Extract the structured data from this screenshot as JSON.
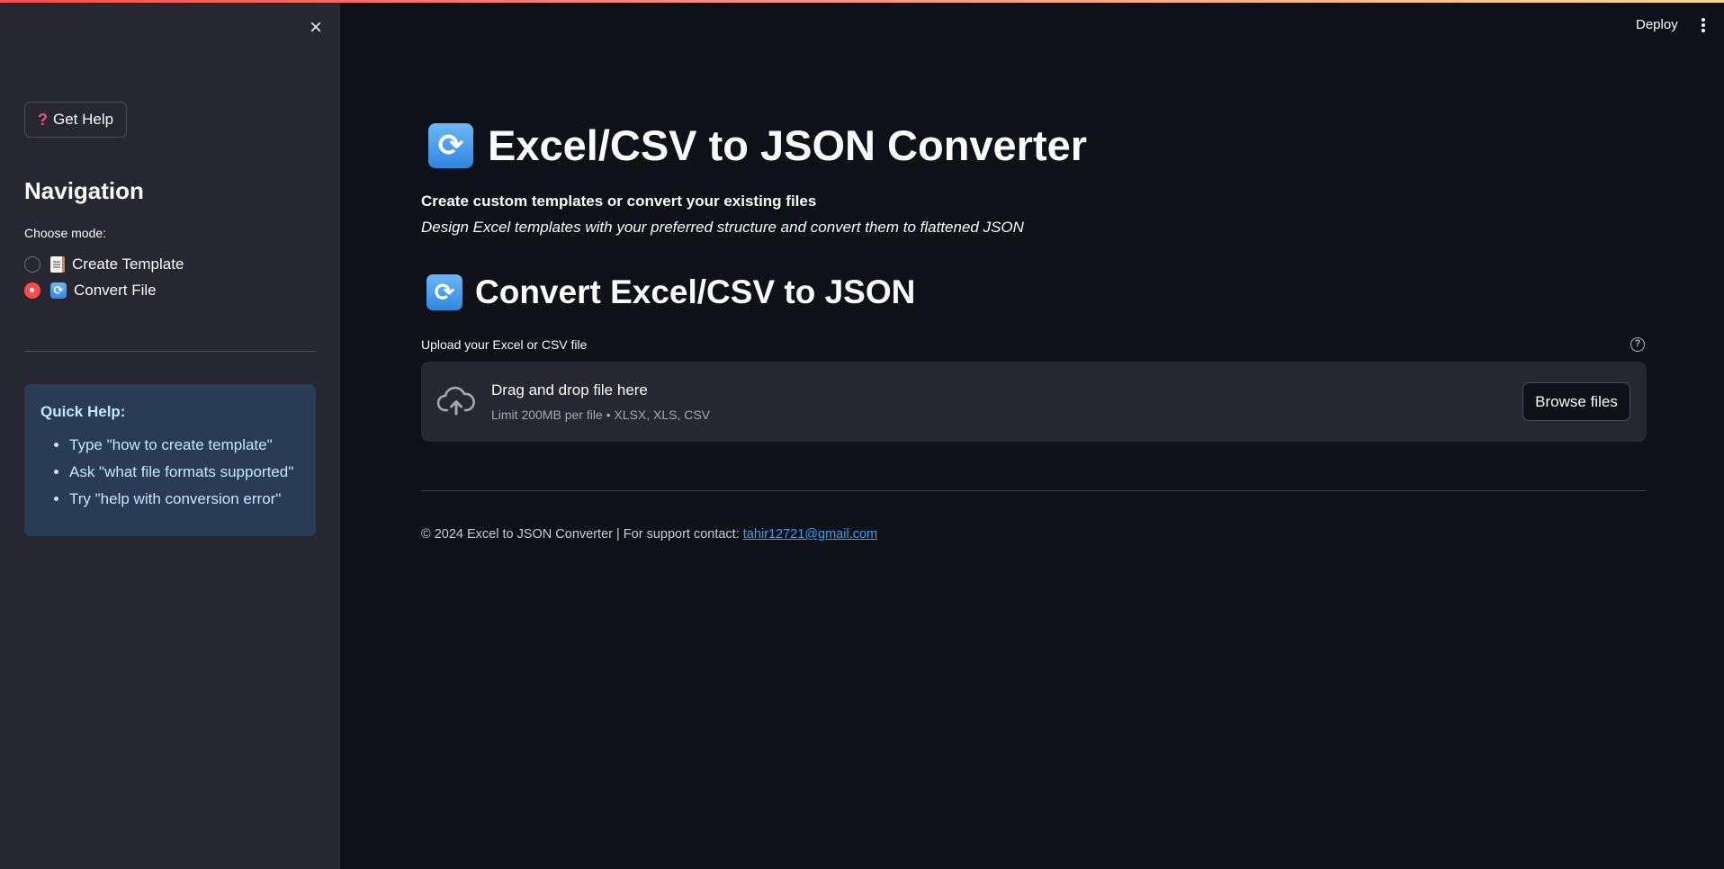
{
  "sidebar": {
    "close_icon": "×",
    "help_button": {
      "icon": "?",
      "label": "Get Help"
    },
    "nav_title": "Navigation",
    "mode_label": "Choose mode:",
    "modes": [
      {
        "label": "Create Template",
        "icon": "page-icon",
        "selected": false
      },
      {
        "label": "Convert File",
        "icon": "refresh-icon",
        "selected": true
      }
    ],
    "quick_help": {
      "title": "Quick Help:",
      "items": [
        "Type \"how to create template\"",
        "Ask \"what file formats supported\"",
        "Try \"help with conversion error\""
      ]
    }
  },
  "header": {
    "deploy_label": "Deploy"
  },
  "main": {
    "title": "Excel/CSV to JSON Converter",
    "subtitle_bold": "Create custom templates or convert your existing files",
    "subtitle_italic": "Design Excel templates with your preferred structure and convert them to flattened JSON",
    "section_title": "Convert Excel/CSV to JSON",
    "upload": {
      "label": "Upload your Excel or CSV file",
      "help_glyph": "?",
      "drop_text": "Drag and drop file here",
      "limit_text": "Limit 200MB per file • XLSX, XLS, CSV",
      "browse_label": "Browse files"
    },
    "footer": {
      "text": "© 2024 Excel to JSON Converter | For support contact: ",
      "email": "tahir12721@gmail.com"
    }
  },
  "colors": {
    "background": "#0e1117",
    "sidebar": "#262730",
    "accent": "#ff4b4b",
    "info_box": "#2a3c55",
    "link": "#3d9df3"
  },
  "refresh_glyph": "⟳"
}
